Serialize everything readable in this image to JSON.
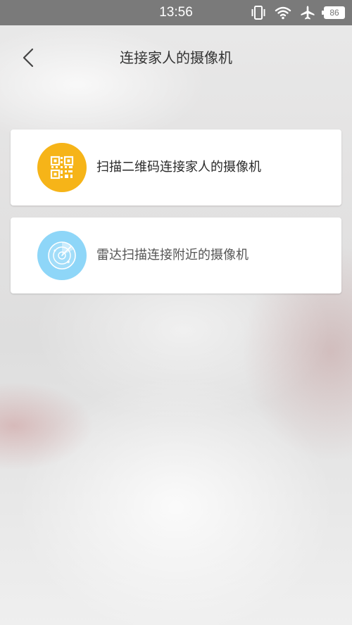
{
  "status_bar": {
    "time": "13:56",
    "battery": "86",
    "icons": [
      "vibrate-icon",
      "wifi-icon",
      "airplane-icon",
      "battery-icon"
    ]
  },
  "header": {
    "title": "连接家人的摄像机",
    "back_icon": "chevron-left-icon"
  },
  "options": [
    {
      "label": "扫描二维码连接家人的摄像机",
      "icon": "qr-code-icon",
      "icon_color": "#f6b418"
    },
    {
      "label": "雷达扫描连接附近的摄像机",
      "icon": "radar-icon",
      "icon_color": "#8ed6f8"
    }
  ]
}
